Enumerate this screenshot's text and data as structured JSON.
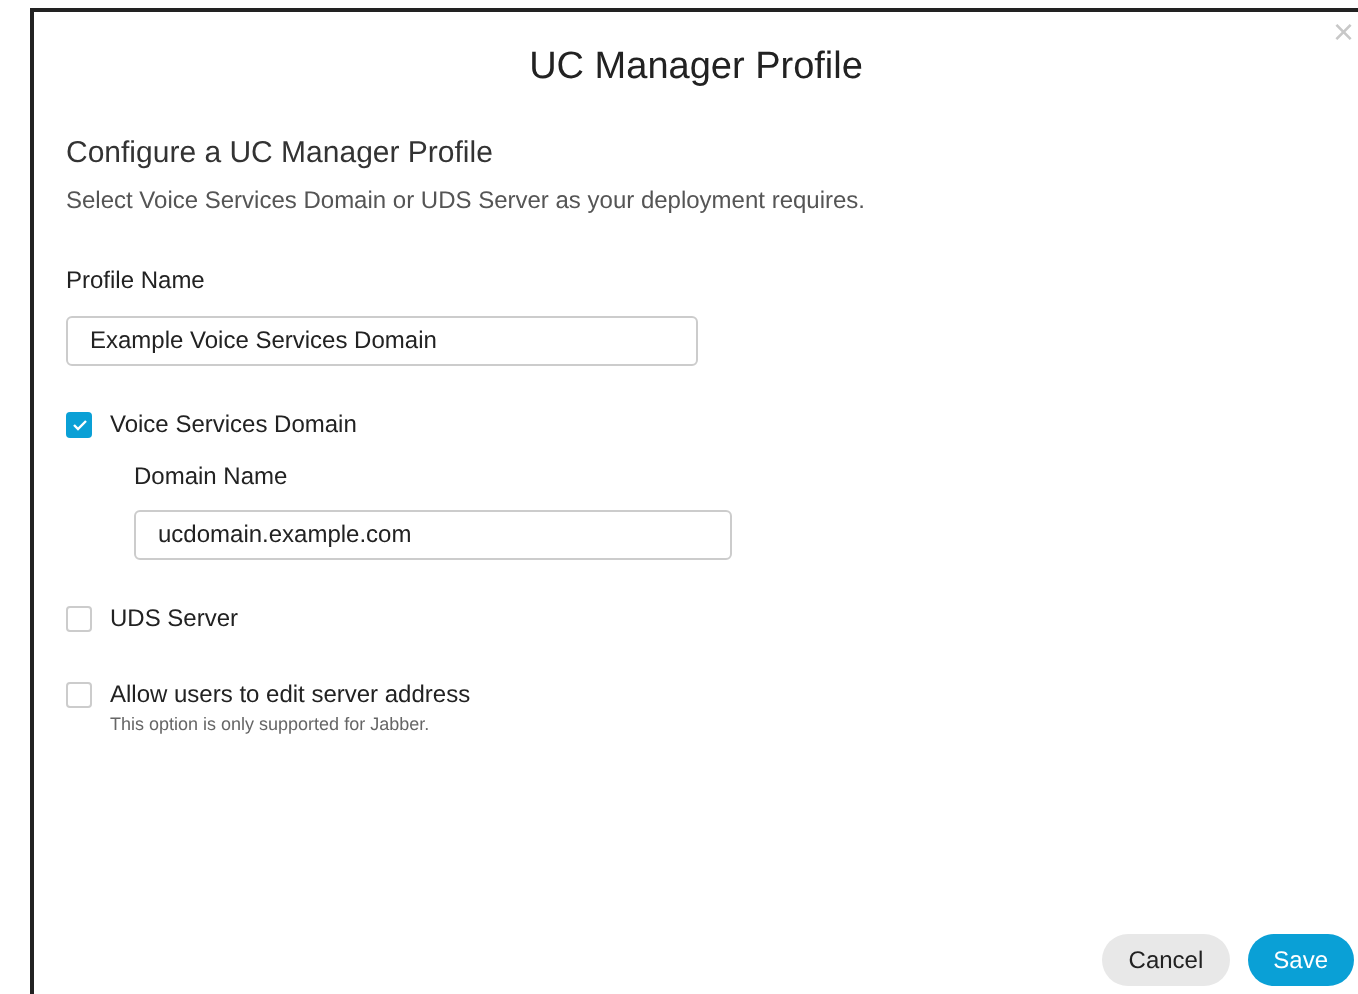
{
  "dialog": {
    "title": "UC Manager Profile",
    "close": "×"
  },
  "heading": "Configure a UC Manager Profile",
  "description": "Select Voice Services Domain or UDS Server as your deployment requires.",
  "profile_name": {
    "label": "Profile Name",
    "value": "Example Voice Services Domain"
  },
  "options": [
    {
      "label": "Voice Services Domain",
      "checked": true,
      "field": {
        "label": "Domain Name",
        "value": "ucdomain.example.com"
      }
    },
    {
      "label": "UDS Server",
      "checked": false
    },
    {
      "label": "Allow users to edit server address",
      "checked": false,
      "note": "This option is only supported for Jabber."
    }
  ],
  "buttons": [
    {
      "label": "Cancel",
      "kind": "secondary"
    },
    {
      "label": "Save",
      "kind": "primary"
    }
  ]
}
